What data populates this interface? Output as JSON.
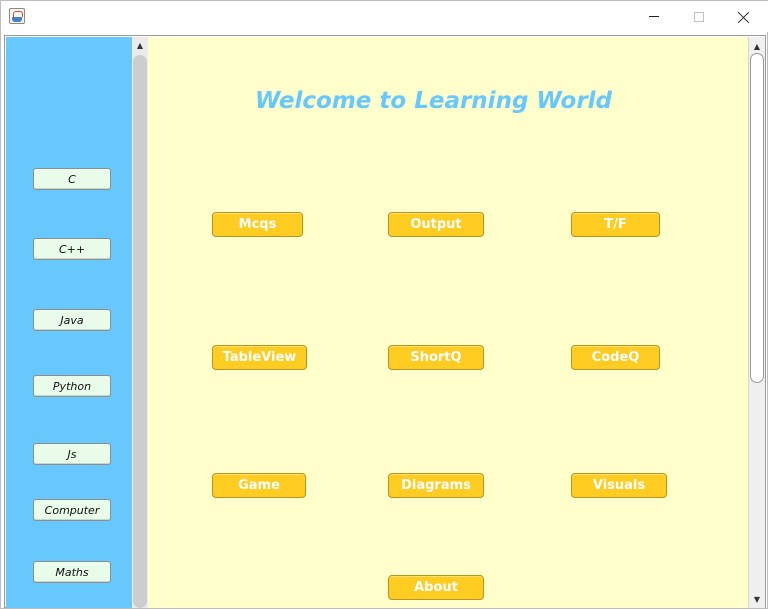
{
  "window": {
    "icon": "java-app-icon",
    "controls": [
      "minimize-icon",
      "maximize-icon",
      "close-icon"
    ]
  },
  "sidebar": {
    "background": "#66c8fc",
    "items": [
      {
        "label": "C"
      },
      {
        "label": "C++"
      },
      {
        "label": "Java"
      },
      {
        "label": "Python"
      },
      {
        "label": "Js"
      },
      {
        "label": "Computer"
      },
      {
        "label": "Maths"
      }
    ]
  },
  "main": {
    "background": "#ffffcc",
    "welcome_text": "Welcome to Learning World",
    "buttons": [
      {
        "label": "Mcqs"
      },
      {
        "label": "Output"
      },
      {
        "label": "T/F"
      },
      {
        "label": "TableView"
      },
      {
        "label": "ShortQ"
      },
      {
        "label": "CodeQ"
      },
      {
        "label": "Game"
      },
      {
        "label": "Diagrams"
      },
      {
        "label": "Visuals"
      },
      {
        "label": "About"
      }
    ],
    "button_color": "#ffcc22"
  }
}
